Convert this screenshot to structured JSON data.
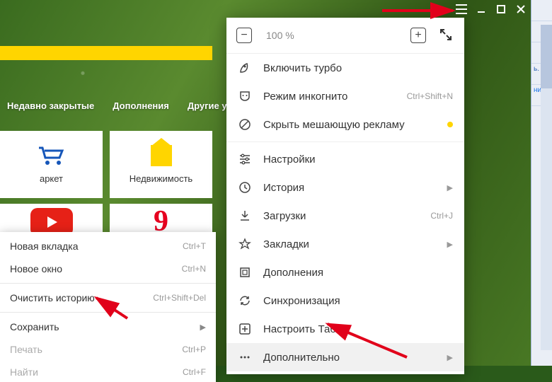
{
  "tabs": {
    "recent": "Недавно закрытые",
    "addons": "Дополнения",
    "other": "Другие устро"
  },
  "tiles": {
    "market": "аркет",
    "realty": "Недвижимость"
  },
  "zoom": {
    "level": "100 %"
  },
  "menu": {
    "turbo": "Включить турбо",
    "incognito": "Режим инкогнито",
    "incognito_sc": "Ctrl+Shift+N",
    "hide_ads": "Скрыть мешающую рекламу",
    "settings": "Настройки",
    "history": "История",
    "downloads": "Загрузки",
    "downloads_sc": "Ctrl+J",
    "bookmarks": "Закладки",
    "addons": "Дополнения",
    "sync": "Синхронизация",
    "tablo": "Настроить Табло",
    "more": "Дополнительно"
  },
  "ctx": {
    "new_tab": "Новая вкладка",
    "new_tab_sc": "Ctrl+T",
    "new_window": "Новое окно",
    "new_window_sc": "Ctrl+N",
    "clear_history": "Очистить историю",
    "clear_history_sc": "Ctrl+Shift+Del",
    "save": "Сохранить",
    "print": "Печать",
    "print_sc": "Ctrl+P",
    "find": "Найти",
    "find_sc": "Ctrl+F"
  },
  "side": {
    "a": "ь.",
    "b": "ние"
  }
}
